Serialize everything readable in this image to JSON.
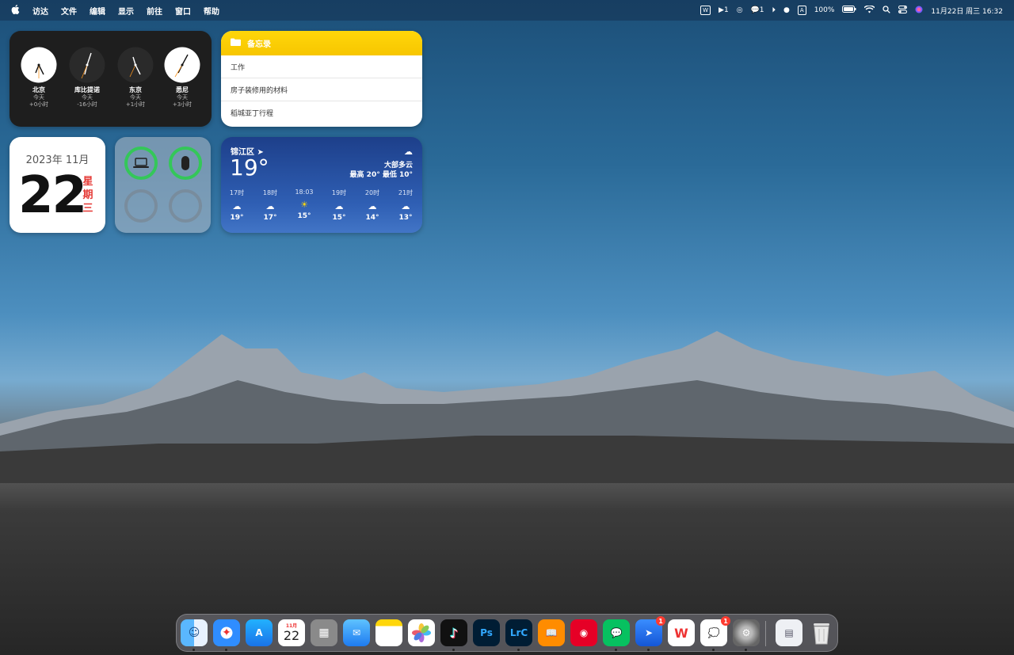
{
  "menubar": {
    "apple": "",
    "items": [
      "访达",
      "文件",
      "编辑",
      "显示",
      "前往",
      "窗口",
      "帮助"
    ],
    "status": {
      "notif1": "1",
      "notif2": "1",
      "input": "A",
      "battery": "100%",
      "datetime": "11月22日 周三  16:32"
    }
  },
  "clocks": [
    {
      "city": "北京",
      "day": "今天",
      "offset": "+0小时"
    },
    {
      "city": "库比提诺",
      "day": "今天",
      "offset": "-16小时"
    },
    {
      "city": "东京",
      "day": "今天",
      "offset": "+1小时"
    },
    {
      "city": "悉尼",
      "day": "今天",
      "offset": "+3小时"
    }
  ],
  "notes": {
    "title": "备忘录",
    "items": [
      "工作",
      "房子装修用的材料",
      "稻城亚丁行程"
    ]
  },
  "calendar": {
    "month": "2023年 11月",
    "day": "22",
    "weekday": [
      "星",
      "期",
      "三"
    ]
  },
  "weather": {
    "city": "锦江区",
    "temp": "19°",
    "condition": "大部多云",
    "range": "最高 20° 最低 10°",
    "hours": [
      {
        "time": "17时",
        "icon": "cloud-icon",
        "temp": "19°"
      },
      {
        "time": "18时",
        "icon": "cloud-icon",
        "temp": "17°"
      },
      {
        "time": "18:03",
        "icon": "sunset-icon",
        "temp": "15°"
      },
      {
        "time": "19时",
        "icon": "cloud-icon",
        "temp": "15°"
      },
      {
        "time": "20时",
        "icon": "cloud-moon-icon",
        "temp": "14°"
      },
      {
        "time": "21时",
        "icon": "cloud-moon-icon",
        "temp": "13°"
      }
    ]
  },
  "dock": {
    "calendar_month": "11月",
    "calendar_day": "22",
    "ps_label": "Ps",
    "lrc_label": "LrC",
    "badge_feishu": "1",
    "badge_chat": "1"
  }
}
